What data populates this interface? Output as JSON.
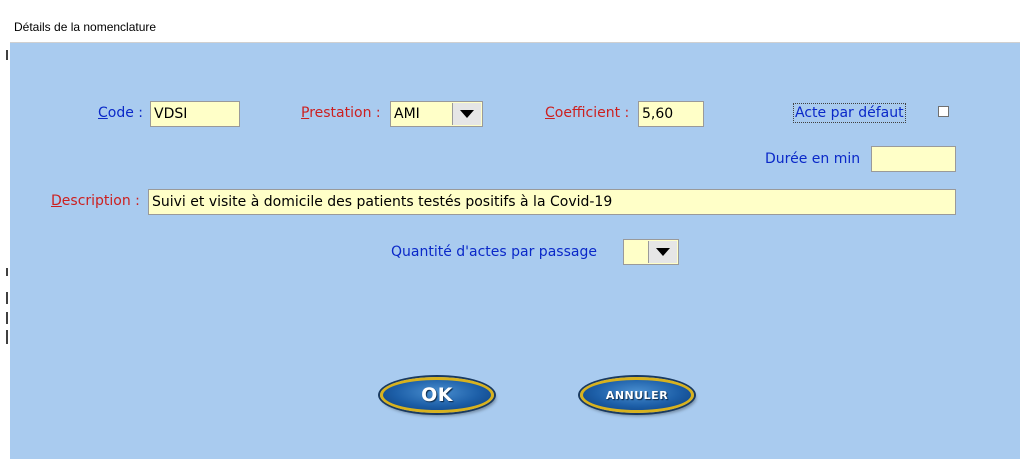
{
  "window": {
    "title": "Détails de la nomenclature"
  },
  "form": {
    "code": {
      "label_u": "C",
      "label_rest": "ode :",
      "value": "VDSI"
    },
    "prestation": {
      "label_u": "P",
      "label_rest": "restation :",
      "value": "AMI"
    },
    "coefficient": {
      "label_u": "C",
      "label_rest": "oefficient :",
      "value": "5,60"
    },
    "acte_par_defaut": {
      "label": "Acte par défaut",
      "checked": false
    },
    "duree": {
      "label": "Durée en min",
      "value": ""
    },
    "description": {
      "label_u": "D",
      "label_rest": "escription :",
      "value": "Suivi et visite à domicile des patients testés positifs à la Covid-19"
    },
    "quantite": {
      "label": "Quantité d'actes par passage",
      "value": ""
    }
  },
  "buttons": {
    "ok": "OK",
    "annuler": "ANNULER"
  },
  "colors": {
    "client_bg": "#a9cbef",
    "field_bg": "#ffffc8",
    "label_blue": "#0a28c8",
    "label_red": "#cc2020"
  }
}
